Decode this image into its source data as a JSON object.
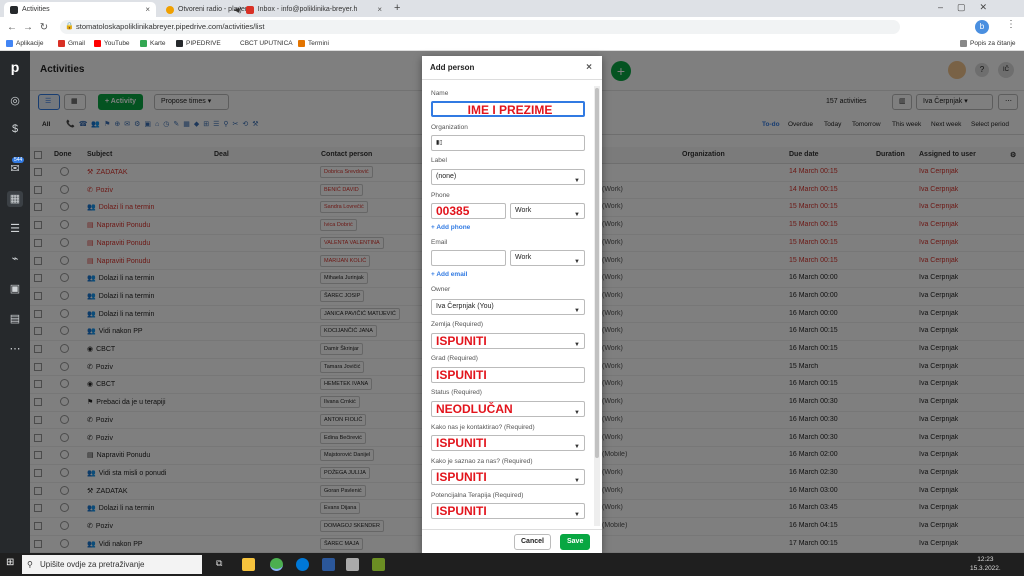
{
  "browser": {
    "tabs": [
      {
        "label": "Activities",
        "color": "#26292c"
      },
      {
        "label": "Otvoreni radio - player",
        "color": "#f0a000"
      },
      {
        "label": "Inbox - info@poliklinika-breyer.h",
        "color": "#d93025"
      }
    ],
    "url": "stomatoloskapoliklinikabreyer.pipedrive.com/activities/list",
    "bookmarks": [
      "Aplikacije",
      "Gmail",
      "YouTube",
      "Karte",
      "PIPEDRIVE",
      "CBCT UPUTNICA",
      "Termini"
    ],
    "reading_list": "Popis za čitanje"
  },
  "app": {
    "title": "Activities",
    "add_activity": "+ Activity",
    "propose_times": "Propose times",
    "count": "157 activities",
    "user": "Iva Čerpnjak",
    "filter_all": "All",
    "ranges": [
      "To-do",
      "Overdue",
      "Today",
      "Tomorrow",
      "This week",
      "Next week",
      "Select period"
    ],
    "avatar": "IČ",
    "badge_mail": "544"
  },
  "table": {
    "headers": [
      "Done",
      "Subject",
      "Deal",
      "Contact person",
      "Organization",
      "Due date",
      "Duration",
      "Assigned to user"
    ],
    "rows": [
      {
        "subject": "ZADATAK",
        "contact": "Dobrica Srevdović",
        "phone": "",
        "due": "14 March 00:15",
        "user": "Iva Čerpnjak",
        "overdue": true
      },
      {
        "subject": "Poziv",
        "contact": "BENIĆ DAVID",
        "phone": "(Work)",
        "due": "14 March 00:15",
        "user": "Iva Čerpnjak",
        "overdue": true
      },
      {
        "subject": "Dolazi li na termin",
        "contact": "Sandra Lovrečić",
        "phone": "(Work)",
        "due": "15 March 00:15",
        "user": "Iva Čerpnjak",
        "overdue": true
      },
      {
        "subject": "Napraviti Ponudu",
        "contact": "Ivica Dobrić",
        "phone": "(Work)",
        "due": "15 March 00:15",
        "user": "Iva Čerpnjak",
        "overdue": true
      },
      {
        "subject": "Napraviti Ponudu",
        "contact": "VALENTA VALENTINA",
        "phone": "(Work)",
        "due": "15 March 00:15",
        "user": "Iva Čerpnjak",
        "overdue": true
      },
      {
        "subject": "Napraviti Ponudu",
        "contact": "MARIJAN KOLIĆ",
        "phone": "(Work)",
        "due": "15 March 00:15",
        "user": "Iva Čerpnjak",
        "overdue": true
      },
      {
        "subject": "Dolazi li na termin",
        "contact": "Mihaela Jurinjak",
        "phone": "(Work)",
        "due": "16 March 00:00",
        "user": "Iva Čerpnjak",
        "overdue": false
      },
      {
        "subject": "Dolazi li na termin",
        "contact": "ŠAREC JOSIP",
        "phone": "(Work)",
        "due": "16 March 00:00",
        "user": "Iva Čerpnjak",
        "overdue": false
      },
      {
        "subject": "Dolazi li na termin",
        "contact": "JANICA PAVIČIĆ MATIJEVIĆ",
        "phone": "(Work)",
        "due": "16 March 00:00",
        "user": "Iva Čerpnjak",
        "overdue": false
      },
      {
        "subject": "Vidi nakon PP",
        "contact": "KOCIJANČIĆ JANA",
        "phone": "(Work)",
        "due": "16 March 00:15",
        "user": "Iva Čerpnjak",
        "overdue": false
      },
      {
        "subject": "CBCT",
        "contact": "Damir Škrinjar",
        "phone": "(Work)",
        "due": "16 March 00:15",
        "user": "Iva Čerpnjak",
        "overdue": false
      },
      {
        "subject": "Poziv",
        "contact": "Tamara Jovičić",
        "phone": "(Work)",
        "due": "15 March",
        "user": "Iva Čerpnjak",
        "overdue": false
      },
      {
        "subject": "CBCT",
        "contact": "HEMETEK IVANA",
        "phone": "(Work)",
        "due": "16 March 00:15",
        "user": "Iva Čerpnjak",
        "overdue": false
      },
      {
        "subject": "Prebaci da je u terapiji",
        "contact": "Ilvana Crnkić",
        "phone": "(Work)",
        "due": "16 March 00:30",
        "user": "Iva Čerpnjak",
        "overdue": false
      },
      {
        "subject": "Poziv",
        "contact": "ANTON FIOLIĆ",
        "phone": "(Work)",
        "due": "16 March 00:30",
        "user": "Iva Čerpnjak",
        "overdue": false
      },
      {
        "subject": "Poziv",
        "contact": "Edina Bečirević",
        "phone": "(Work)",
        "due": "16 March 00:30",
        "user": "Iva Čerpnjak",
        "overdue": false
      },
      {
        "subject": "Napraviti Ponudu",
        "contact": "Majstorović Danijel",
        "phone": "(Mobile)",
        "due": "16 March 02:00",
        "user": "Iva Čerpnjak",
        "overdue": false
      },
      {
        "subject": "Vidi sta misli o ponudi",
        "contact": "POŽEGA JULIJA",
        "phone": "(Work)",
        "due": "16 March 02:30",
        "user": "Iva Čerpnjak",
        "overdue": false
      },
      {
        "subject": "ZADATAK",
        "contact": "Goran Pavlenić",
        "phone": "(Work)",
        "due": "16 March 03:00",
        "user": "Iva Čerpnjak",
        "overdue": false
      },
      {
        "subject": "Dolazi li na termin",
        "contact": "Evans Dijana",
        "phone": "(Work)",
        "due": "16 March 03:45",
        "user": "Iva Čerpnjak",
        "overdue": false
      },
      {
        "subject": "Poziv",
        "contact": "DOMAGOJ SKENDER",
        "phone": "(Mobile)",
        "due": "16 March 04:15",
        "user": "Iva Čerpnjak",
        "overdue": false
      },
      {
        "subject": "Vidi nakon PP",
        "contact": "ŠAREC MAJA",
        "phone": "",
        "due": "17 March 00:15",
        "user": "Iva Čerpnjak",
        "overdue": false
      }
    ]
  },
  "modal": {
    "title": "Add person",
    "name_label": "Name",
    "name_value": "IME I PREZIME",
    "org_label": "Organization",
    "label_label": "Label",
    "label_value": "(none)",
    "phone_label": "Phone",
    "phone_value": "00385",
    "phone_type": "Work",
    "add_phone": "+ Add phone",
    "email_label": "Email",
    "email_type": "Work",
    "add_email": "+ Add email",
    "owner_label": "Owner",
    "owner_value": "Iva Čerpnjak (You)",
    "zemlja_label": "Zemlja (Required)",
    "zemlja_value": "ISPUNITI",
    "grad_label": "Grad (Required)",
    "grad_value": "ISPUNITI",
    "status_label": "Status (Required)",
    "status_value": "NEODLUČAN",
    "kontakt_label": "Kako nas je kontaktirao? (Required)",
    "kontakt_value": "ISPUNITI",
    "saznao_label": "Kako je saznao za nas? (Required)",
    "saznao_value": "ISPUNITI",
    "terapija_label": "Potencijalna Terapija (Required)",
    "terapija_value": "ISPUNITI",
    "cancel": "Cancel",
    "save": "Save"
  },
  "taskbar": {
    "search": "Upišite ovdje za pretraživanje",
    "time": "12:23",
    "date": "15.3.2022."
  }
}
